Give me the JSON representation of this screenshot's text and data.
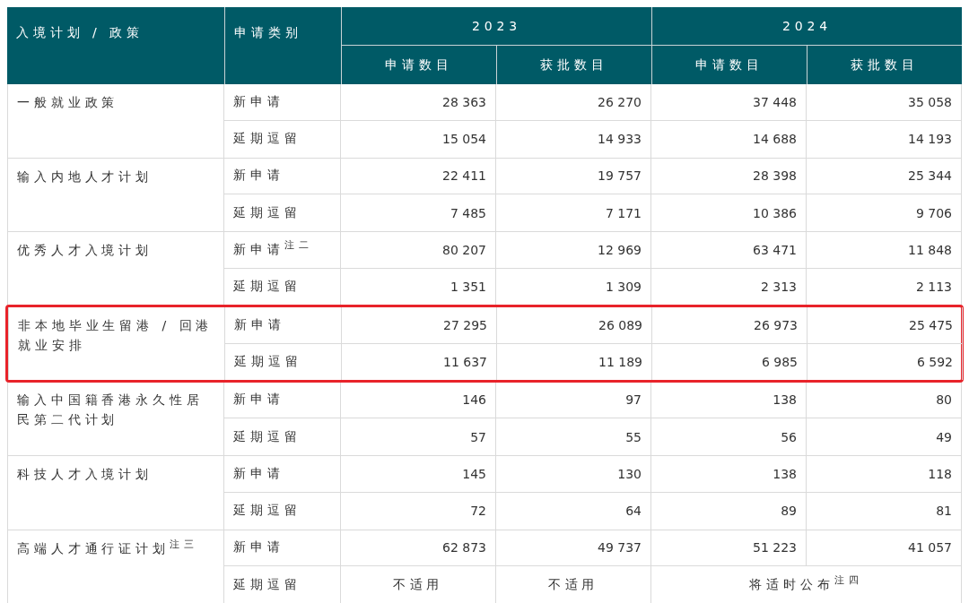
{
  "table": {
    "header": {
      "policy": "入境计划 / 政策",
      "category": "申请类别",
      "years": [
        {
          "label": "2023",
          "columns": [
            "申请数目",
            "获批数目"
          ]
        },
        {
          "label": "2024",
          "columns": [
            "申请数目",
            "获批数目"
          ]
        }
      ]
    },
    "groups": [
      {
        "policy": "一般就业政策",
        "highlighted": false,
        "rows": [
          {
            "category": "新申请",
            "cells": [
              {
                "kind": "number",
                "text": "28 363"
              },
              {
                "kind": "number",
                "text": "26 270"
              },
              {
                "kind": "number",
                "text": "37 448"
              },
              {
                "kind": "number",
                "text": "35 058"
              }
            ]
          },
          {
            "category": "延期逗留",
            "cells": [
              {
                "kind": "number",
                "text": "15 054"
              },
              {
                "kind": "number",
                "text": "14 933"
              },
              {
                "kind": "number",
                "text": "14 688"
              },
              {
                "kind": "number",
                "text": "14 193"
              }
            ]
          }
        ]
      },
      {
        "policy": "输入内地人才计划",
        "highlighted": false,
        "rows": [
          {
            "category": "新申请",
            "cells": [
              {
                "kind": "number",
                "text": "22 411"
              },
              {
                "kind": "number",
                "text": "19 757"
              },
              {
                "kind": "number",
                "text": "28 398"
              },
              {
                "kind": "number",
                "text": "25 344"
              }
            ]
          },
          {
            "category": "延期逗留",
            "cells": [
              {
                "kind": "number",
                "text": "7 485"
              },
              {
                "kind": "number",
                "text": "7 171"
              },
              {
                "kind": "number",
                "text": "10 386"
              },
              {
                "kind": "number",
                "text": "9 706"
              }
            ]
          }
        ]
      },
      {
        "policy": "优秀人才入境计划",
        "highlighted": false,
        "rows": [
          {
            "category": "新申请$^{注二}$",
            "cells": [
              {
                "kind": "number",
                "text": "80 207"
              },
              {
                "kind": "number",
                "text": "12 969"
              },
              {
                "kind": "number",
                "text": "63 471"
              },
              {
                "kind": "number",
                "text": "11 848"
              }
            ]
          },
          {
            "category": "延期逗留",
            "cells": [
              {
                "kind": "number",
                "text": "1 351"
              },
              {
                "kind": "number",
                "text": "1 309"
              },
              {
                "kind": "number",
                "text": "2 313"
              },
              {
                "kind": "number",
                "text": "2 113"
              }
            ]
          }
        ]
      },
      {
        "policy": "非本地毕业生留港 / 回港就业安排",
        "highlighted": true,
        "rows": [
          {
            "category": "新申请",
            "cells": [
              {
                "kind": "number",
                "text": "27 295"
              },
              {
                "kind": "number",
                "text": "26 089"
              },
              {
                "kind": "number",
                "text": "26 973"
              },
              {
                "kind": "number",
                "text": "25 475"
              }
            ]
          },
          {
            "category": "延期逗留",
            "cells": [
              {
                "kind": "number",
                "text": "11 637"
              },
              {
                "kind": "number",
                "text": "11 189"
              },
              {
                "kind": "number",
                "text": "6 985"
              },
              {
                "kind": "number",
                "text": "6 592"
              }
            ]
          }
        ]
      },
      {
        "policy": "输入中国籍香港永久性居民第二代计划",
        "highlighted": false,
        "rows": [
          {
            "category": "新申请",
            "cells": [
              {
                "kind": "number",
                "text": "146"
              },
              {
                "kind": "number",
                "text": "97"
              },
              {
                "kind": "number",
                "text": "138"
              },
              {
                "kind": "number",
                "text": "80"
              }
            ]
          },
          {
            "category": "延期逗留",
            "cells": [
              {
                "kind": "number",
                "text": "57"
              },
              {
                "kind": "number",
                "text": "55"
              },
              {
                "kind": "number",
                "text": "56"
              },
              {
                "kind": "number",
                "text": "49"
              }
            ]
          }
        ]
      },
      {
        "policy": "科技人才入境计划",
        "highlighted": false,
        "rows": [
          {
            "category": "新申请",
            "cells": [
              {
                "kind": "number",
                "text": "145"
              },
              {
                "kind": "number",
                "text": "130"
              },
              {
                "kind": "number",
                "text": "138"
              },
              {
                "kind": "number",
                "text": "118"
              }
            ]
          },
          {
            "category": "延期逗留",
            "cells": [
              {
                "kind": "number",
                "text": "72"
              },
              {
                "kind": "number",
                "text": "64"
              },
              {
                "kind": "number",
                "text": "89"
              },
              {
                "kind": "number",
                "text": "81"
              }
            ]
          }
        ]
      },
      {
        "policy": "高端人才通行证计划$^{注三}$",
        "highlighted": false,
        "rows": [
          {
            "category": "新申请",
            "cells": [
              {
                "kind": "number",
                "text": "62 873"
              },
              {
                "kind": "number",
                "text": "49 737"
              },
              {
                "kind": "number",
                "text": "51 223"
              },
              {
                "kind": "number",
                "text": "41 057"
              }
            ]
          },
          {
            "category": "延期逗留",
            "cells": [
              {
                "kind": "text",
                "text": "不适用"
              },
              {
                "kind": "text",
                "text": "不适用"
              },
              {
                "kind": "merged",
                "text": "将适时公布$^{注四}$"
              }
            ]
          }
        ]
      }
    ]
  }
}
